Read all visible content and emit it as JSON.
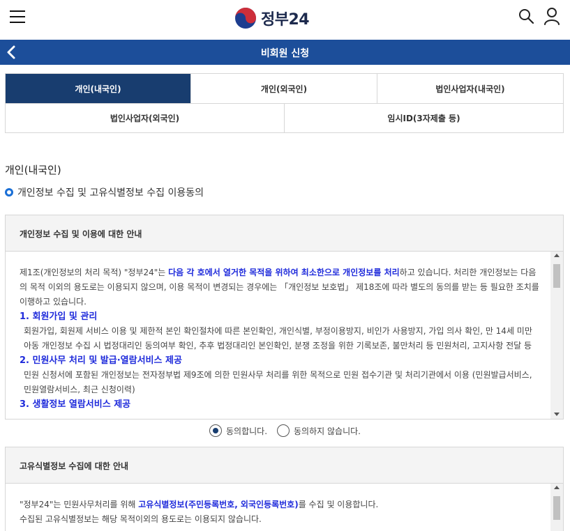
{
  "header": {
    "logo_text": "정부24",
    "menu_icon": "hamburger-menu-icon",
    "search_icon": "search-icon",
    "user_icon": "user-icon",
    "brand_color": "#1c4e9a"
  },
  "titlebar": {
    "title": "비회원 신청",
    "back_icon": "chevron-left-icon"
  },
  "tabs": [
    {
      "label": "개인(내국인)",
      "active": true
    },
    {
      "label": "개인(외국인)",
      "active": false
    },
    {
      "label": "법인사업자(내국인)",
      "active": false
    },
    {
      "label": "법인사업자(외국인)",
      "active": false
    },
    {
      "label": "임시ID(3자제출 등)",
      "active": false
    }
  ],
  "section_title": "개인(내국인)",
  "consent_heading": "개인정보 수집 및 고유식별정보 수집 이용동의",
  "box1": {
    "head": "개인정보 수집 및 이용에 대한 안내",
    "intro_pre": "제1조(개인정보의 처리 목적) \"정부24\"는 ",
    "intro_hl": "다음 각 호에서 열거한 목적을 위하여 최소한으로 개인정보를 처리",
    "intro_post": "하고 있습니다. 처리한 개인정보는 다음의 목적 이외의 용도로는 이용되지 않으며, 이용 목적이 변경되는 경우에는 「개인정보 보호법」 제18조에 따라 별도의 동의를 받는 등 필요한 조치를 이행하고 있습니다.",
    "item1_title": "1. 회원가입 및 관리",
    "item1_text": "회원가입, 회원제 서비스 이용 및 제한적 본인 확인절차에 따른 본인확인, 개인식별, 부정이용방지, 비인가 사용방지, 가입 의사 확인, 만 14세 미만 아동 개인정보 수집 시 법정대리인 동의여부 확인, 추후 법정대리인 본인확인, 분쟁 조정을 위한 기록보존, 불만처리 등 민원처리, 고지사항 전달 등",
    "item2_title": "2. 민원사무 처리 및 발급·열람서비스 제공",
    "item2_text": "민원 신청서에 포함된 개인정보는 전자정부법 제9조에 의한 민원사무 처리를 위한 목적으로 민원 접수기관 및 처리기관에서 이용 (민원발급서비스, 민원열람서비스, 최근 신청이력)",
    "item3_title": "3. 생활정보 열람서비스 제공"
  },
  "radio": {
    "agree": "동의합니다.",
    "disagree": "동의하지 않습니다.",
    "selected": "agree"
  },
  "box2": {
    "head": "고유식별정보 수집에 대한 안내",
    "line1_pre": "\"정부24\"는 민원사무처리를 위해 ",
    "line1_hl": "고유식별정보(주민등록번호, 외국인등록번호)",
    "line1_post": "를 수집 및 이용합니다.",
    "line2": "수집된 고유식별정보는 해당 목적이외의 용도로는 이용되지 않습니다."
  }
}
